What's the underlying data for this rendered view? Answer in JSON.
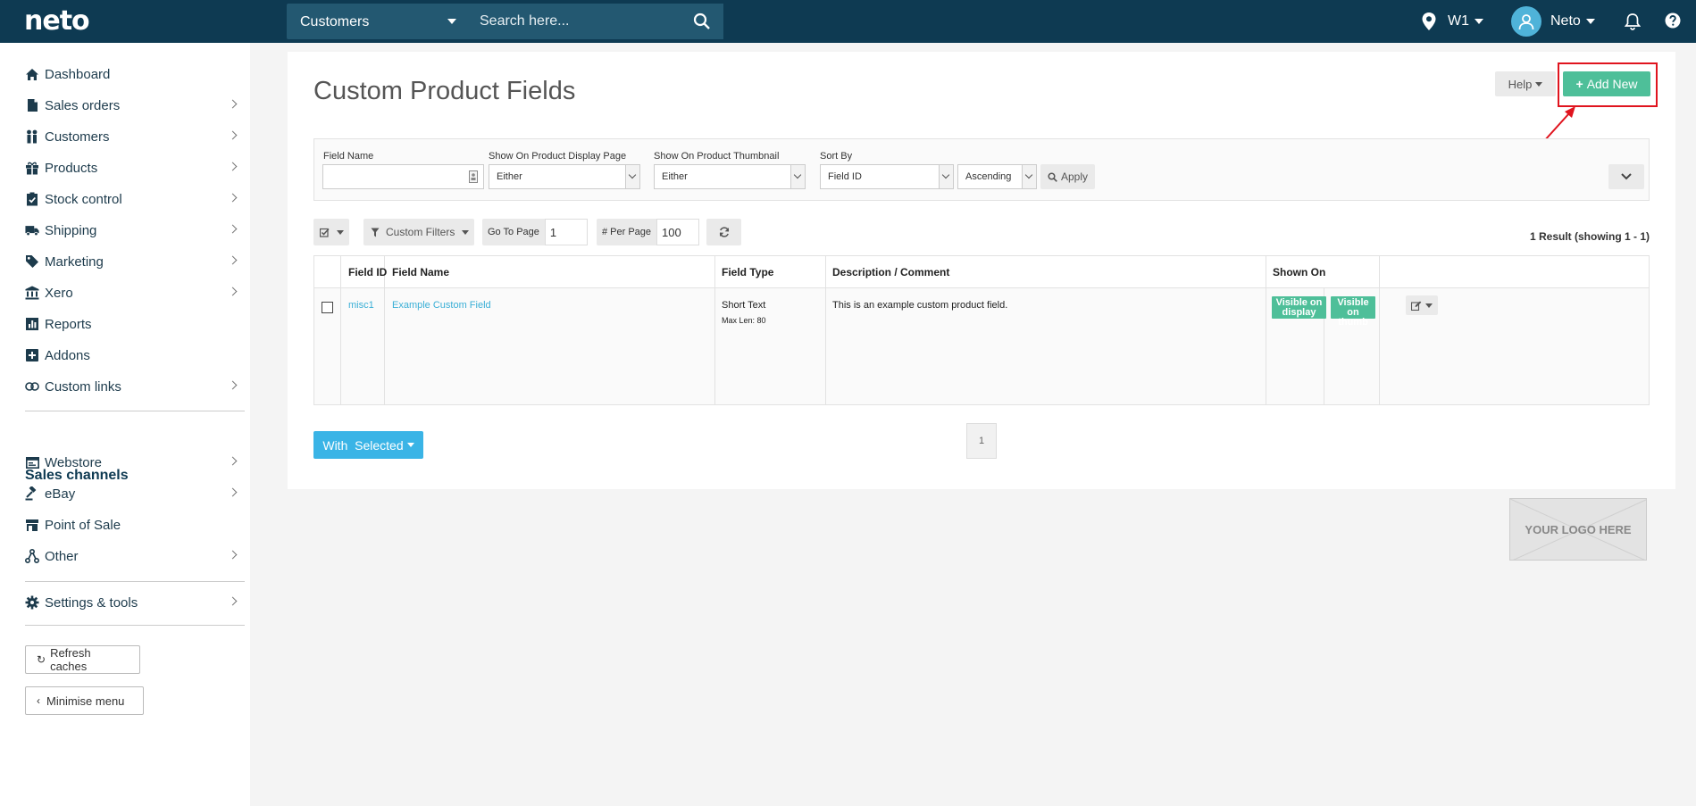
{
  "topbar": {
    "logo": "neto",
    "search_category": "Customers",
    "search_placeholder": "Search here...",
    "location": "W1",
    "user": "Neto"
  },
  "sidebar": {
    "items": [
      {
        "label": "Dashboard",
        "icon": "home-icon",
        "chevron": false
      },
      {
        "label": "Sales orders",
        "icon": "document-icon",
        "chevron": true
      },
      {
        "label": "Customers",
        "icon": "users-icon",
        "chevron": true
      },
      {
        "label": "Products",
        "icon": "gift-icon",
        "chevron": true
      },
      {
        "label": "Stock control",
        "icon": "clipboard-check-icon",
        "chevron": true
      },
      {
        "label": "Shipping",
        "icon": "truck-icon",
        "chevron": true
      },
      {
        "label": "Marketing",
        "icon": "tag-icon",
        "chevron": true
      },
      {
        "label": "Xero",
        "icon": "bank-icon",
        "chevron": true
      },
      {
        "label": "Reports",
        "icon": "chart-icon",
        "chevron": false
      },
      {
        "label": "Addons",
        "icon": "plus-square-icon",
        "chevron": false
      },
      {
        "label": "Custom links",
        "icon": "link-icon",
        "chevron": true
      }
    ],
    "sales_channels_heading": "Sales channels",
    "channels": [
      {
        "label": "Webstore",
        "icon": "browser-icon",
        "chevron": true
      },
      {
        "label": "eBay",
        "icon": "gavel-icon",
        "chevron": true
      },
      {
        "label": "Point of Sale",
        "icon": "store-icon",
        "chevron": false
      },
      {
        "label": "Other",
        "icon": "network-icon",
        "chevron": true
      }
    ],
    "settings": "Settings & tools",
    "refresh_caches": "Refresh caches",
    "minimise_menu": "Minimise menu"
  },
  "main": {
    "title": "Custom Product Fields",
    "help": "Help",
    "add_new": "Add New",
    "filters": {
      "field_name_label": "Field Name",
      "display_label": "Show On Product Display Page",
      "display_value": "Either",
      "thumb_label": "Show On Product Thumbnail",
      "thumb_value": "Either",
      "sort_label": "Sort By",
      "sort_value": "Field ID",
      "order_value": "Ascending",
      "apply": "Apply"
    },
    "toolbar": {
      "custom_filters": "Custom Filters",
      "go_to_page_label": "Go To Page",
      "go_to_page_value": "1",
      "per_page_label": "# Per Page",
      "per_page_value": "100"
    },
    "result_count": "1 Result (showing 1 - 1)",
    "table": {
      "headers": [
        "Field ID",
        "Field Name",
        "Field Type",
        "Description / Comment",
        "Shown On"
      ],
      "rows": [
        {
          "field_id": "misc1",
          "field_name": "Example Custom Field",
          "field_type": "Short Text",
          "max_len": "Max Len: 80",
          "description": "This is an example custom product field.",
          "badge_display": "Visible on display",
          "badge_thumb": "Visible on thumb"
        }
      ]
    },
    "with_selected": "With  Selected",
    "page": "1",
    "logo_placeholder": "YOUR LOGO HERE"
  },
  "colors": {
    "topbar": "#0e3a52",
    "accent_green": "#4ebf99",
    "accent_blue": "#3ab4e6",
    "link": "#3aafd6",
    "highlight": "#e0141e"
  }
}
